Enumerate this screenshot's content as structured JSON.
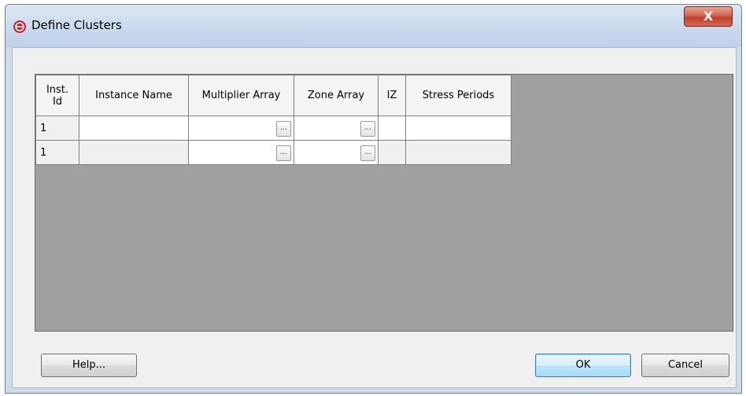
{
  "window": {
    "title": "Define Clusters",
    "icon": "app-logo-icon",
    "close_label": "X"
  },
  "grid": {
    "columns": [
      "Inst. Id",
      "Instance Name",
      "Multiplier Array",
      "Zone Array",
      "IZ",
      "Stress Periods"
    ],
    "rows": [
      {
        "inst_id": "1",
        "instance_name": "",
        "multiplier_array": "",
        "zone_array": "",
        "iz": "",
        "stress_periods": ""
      },
      {
        "inst_id": "1",
        "instance_name": "",
        "multiplier_array": "",
        "zone_array": "",
        "iz": "",
        "stress_periods": ""
      }
    ],
    "ellipsis_label": "..."
  },
  "buttons": {
    "help": "Help...",
    "ok": "OK",
    "cancel": "Cancel"
  },
  "colors": {
    "grid_background": "#a0a0a0",
    "close_button": "#c0402b",
    "app_icon": "#c7232b"
  }
}
